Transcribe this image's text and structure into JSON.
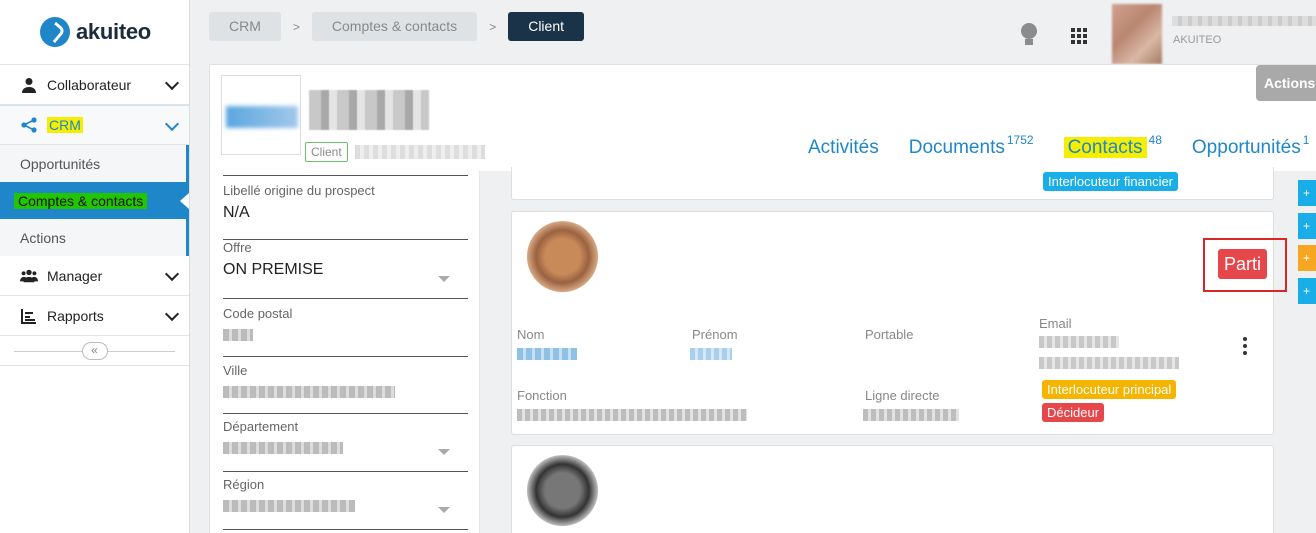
{
  "app": {
    "logo_text": "akuiteo"
  },
  "sidebar": {
    "items": [
      {
        "label": "Collaborateur",
        "icon": "user-icon"
      },
      {
        "label": "CRM",
        "icon": "share-icon"
      },
      {
        "label": "Manager",
        "icon": "users-icon"
      },
      {
        "label": "Rapports",
        "icon": "chart-icon"
      }
    ],
    "crm_sub": [
      {
        "label": "Opportunités"
      },
      {
        "label": "Comptes & contacts"
      },
      {
        "label": "Actions"
      }
    ],
    "collapse_label": "«"
  },
  "breadcrumb": [
    "CRM",
    "Comptes & contacts",
    "Client"
  ],
  "breadcrumb_sep": ">",
  "user": {
    "company": "AKUITEO"
  },
  "actions_label": "Actions",
  "account": {
    "badge": "Client"
  },
  "tabs": [
    {
      "label": "Activités",
      "count": ""
    },
    {
      "label": "Documents",
      "count": "1752"
    },
    {
      "label": "Contacts",
      "count": "48"
    },
    {
      "label": "Opportunités",
      "count": "1"
    }
  ],
  "fields": [
    {
      "label": "Libellé origine du prospect",
      "value": "N/A"
    },
    {
      "label": "Offre",
      "value": "ON PREMISE"
    },
    {
      "label": "Code postal",
      "value": ""
    },
    {
      "label": "Ville",
      "value": ""
    },
    {
      "label": "Département",
      "value": ""
    },
    {
      "label": "Région",
      "value": ""
    }
  ],
  "contact_prev": {
    "tag": "Interlocuteur financier"
  },
  "contact": {
    "status": "Parti",
    "labels": {
      "nom": "Nom",
      "prenom": "Prénom",
      "portable": "Portable",
      "email": "Email",
      "fonction": "Fonction",
      "ligne_directe": "Ligne directe"
    },
    "tags": [
      "Interlocuteur principal",
      "Décideur"
    ]
  },
  "side_buttons": [
    "+",
    "+",
    "+",
    "+"
  ],
  "colors": {
    "accent": "#1f87c9",
    "dark": "#1b3348",
    "danger": "#e6474a",
    "warning": "#f5b400",
    "info": "#1aaee8"
  }
}
